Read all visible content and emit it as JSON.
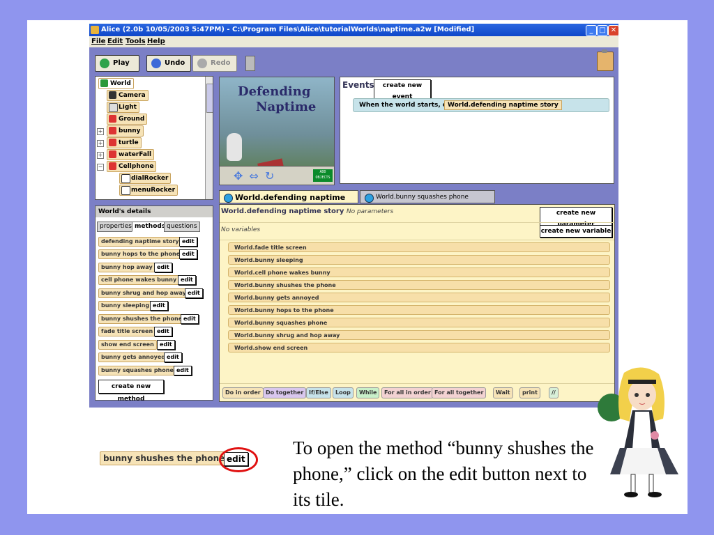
{
  "window": {
    "title": "Alice (2.0b 10/05/2003  5:47PM) - C:\\Program Files\\Alice\\tutorialWorlds\\naptime.a2w [Modified]",
    "minimize": "_",
    "maximize": "□",
    "close": "✕"
  },
  "menu": {
    "file": "File",
    "edit": "Edit",
    "tools": "Tools",
    "help": "Help"
  },
  "toolbar": {
    "play": "Play",
    "undo": "Undo",
    "redo": "Redo"
  },
  "tree": {
    "root": "World",
    "items": [
      "Camera",
      "Light",
      "Ground",
      "bunny",
      "turtle",
      "waterFall",
      "Cellphone",
      "dialRocker",
      "menuRocker"
    ]
  },
  "scene": {
    "title_line1": "Defending",
    "title_line2": "Naptime",
    "add_objects": "ADD OBJECTS"
  },
  "events": {
    "title": "Events",
    "create_new_event": "create new event",
    "row_text": "When the world starts,  do",
    "row_tile": "World.defending naptime story",
    "row_dash": "—"
  },
  "details": {
    "title": "World's details",
    "tabs": [
      "properties",
      "methods",
      "questions"
    ],
    "methods": [
      "defending naptime story",
      "bunny hops to the phone",
      "bunny hop away",
      "cell phone wakes bunny",
      "bunny shrug and hop away",
      "bunny sleeping",
      "bunny shushes the phone",
      "fade title screen",
      "show end screen",
      "bunny gets annoyed",
      "bunny squashes phone"
    ],
    "edit_label": "edit",
    "create_new_method": "create new method"
  },
  "editor": {
    "tabs": [
      "World.defending naptime story",
      "World.bunny squashes phone"
    ],
    "method_name": "World.defending naptime story",
    "no_params": "No parameters",
    "create_new_parameter": "create new parameter",
    "no_variables": "No variables",
    "create_new_variable": "create new variable",
    "statements": [
      "World.fade title screen",
      "World.bunny sleeping",
      "World.cell phone wakes bunny",
      "World.bunny shushes the phone",
      "World.bunny gets annoyed",
      "World.bunny hops to the phone",
      "World.bunny squashes phone",
      "World.bunny shrug and hop away",
      "World.show end screen"
    ],
    "controls": [
      "Do in order",
      "Do together",
      "If/Else",
      "Loop",
      "While",
      "For all in order",
      "For all together",
      "Wait",
      "print",
      "//"
    ]
  },
  "zoom": {
    "tile": "bunny shushes the phone",
    "edit": "edit"
  },
  "caption": "To open the method “bunny shushes the phone,” click on the edit button next to its tile.",
  "colors": {
    "background": "#8f95ee",
    "window_frame": "#7b7fc6",
    "tile": "#f6e3b7",
    "editor_bg": "#fdf4c6",
    "highlight": "#e01010"
  }
}
